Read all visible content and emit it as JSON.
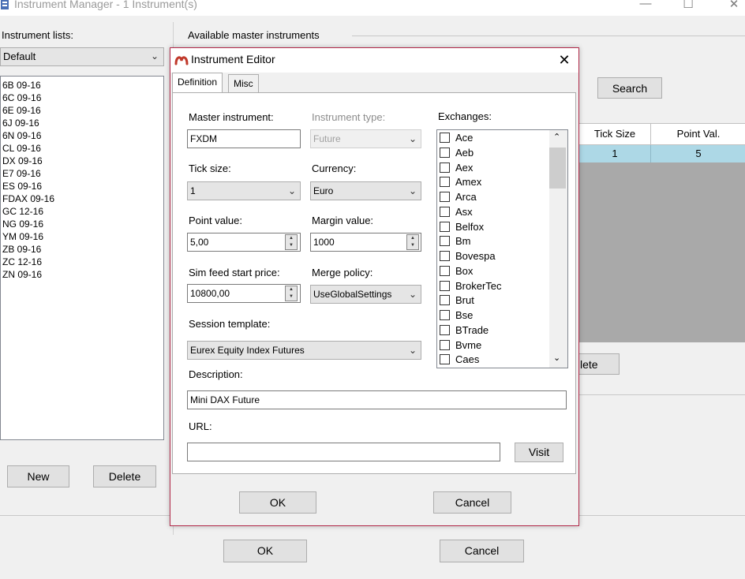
{
  "window": {
    "title": "Instrument Manager - 1 Instrument(s)",
    "minimize": "—",
    "maximize": "☐",
    "close": "✕"
  },
  "left_panel": {
    "lists_label": "Instrument lists:",
    "selected_list": "Default",
    "instruments": [
      "6B 09-16",
      "6C 09-16",
      "6E 09-16",
      "6J 09-16",
      "6N 09-16",
      "CL 09-16",
      "DX 09-16",
      "E7 09-16",
      "ES 09-16",
      "FDAX 09-16",
      "GC 12-16",
      "NG 09-16",
      "YM 09-16",
      "ZB 09-16",
      "ZC 12-16",
      "ZN 09-16"
    ],
    "new_label": "New",
    "delete_label": "Delete"
  },
  "right_panel": {
    "available_label": "Available master instruments",
    "search_label": "Search",
    "columns": [
      "Tick Size",
      "Point Val."
    ],
    "rows": [
      [
        "1",
        "5"
      ]
    ],
    "delete_partial_label": "lete",
    "selected_row_color": "#add8e6"
  },
  "main_buttons": {
    "ok": "OK",
    "cancel": "Cancel"
  },
  "dialog": {
    "title": "Instrument Editor",
    "close": "✕",
    "tabs": [
      "Definition",
      "Misc"
    ],
    "master_instrument": {
      "label": "Master instrument:",
      "value": "FXDM"
    },
    "instrument_type": {
      "label": "Instrument type:",
      "value": "Future"
    },
    "tick_size": {
      "label": "Tick size:",
      "value": "1"
    },
    "currency": {
      "label": "Currency:",
      "value": "Euro"
    },
    "point_value": {
      "label": "Point value:",
      "value": "5,00"
    },
    "margin_value": {
      "label": "Margin value:",
      "value": "1000"
    },
    "sim_feed_start_price": {
      "label": "Sim feed start price:",
      "value": "10800,00"
    },
    "merge_policy": {
      "label": "Merge policy:",
      "value": "UseGlobalSettings"
    },
    "session_template": {
      "label": "Session template:",
      "value": "Eurex Equity Index Futures"
    },
    "description": {
      "label": "Description:",
      "value": "Mini DAX Future"
    },
    "url": {
      "label": "URL:",
      "value": ""
    },
    "visit_label": "Visit",
    "exchanges": {
      "label": "Exchanges:",
      "items": [
        "Ace",
        "Aeb",
        "Aex",
        "Amex",
        "Arca",
        "Asx",
        "Belfox",
        "Bm",
        "Bovespa",
        "Box",
        "BrokerTec",
        "Brut",
        "Bse",
        "BTrade",
        "Bvme",
        "Caes"
      ]
    },
    "ok": "OK",
    "cancel": "Cancel",
    "accent_color": "#b22a4a"
  }
}
